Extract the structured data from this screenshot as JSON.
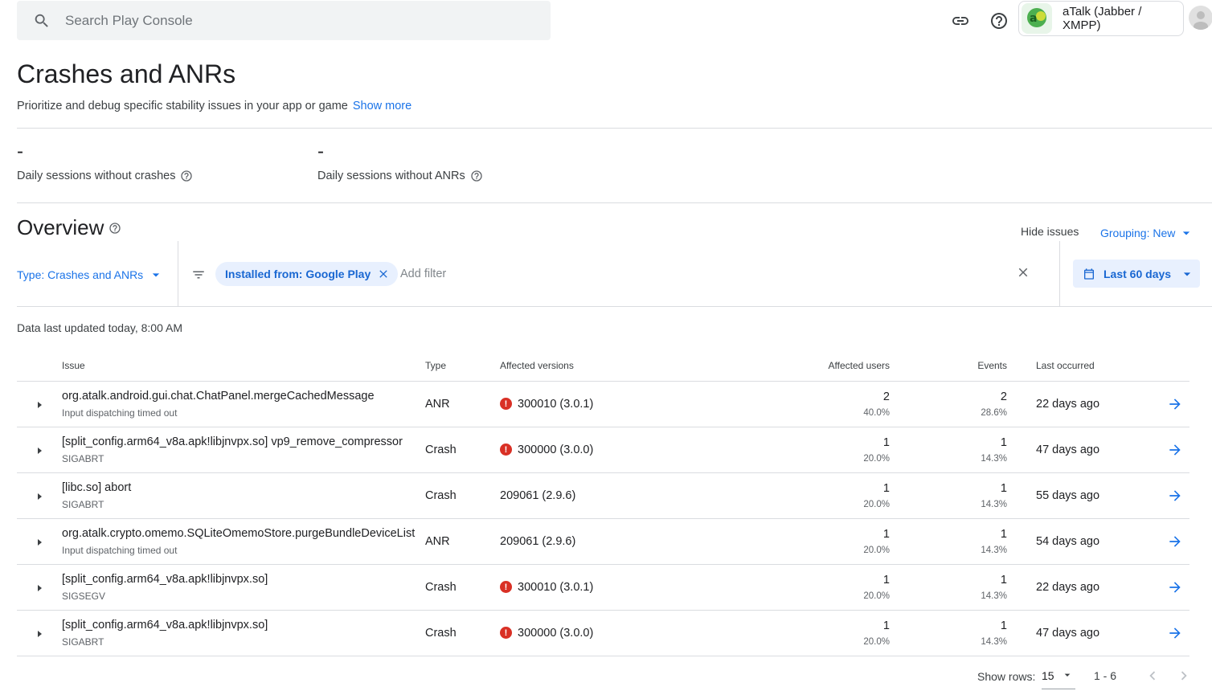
{
  "search": {
    "placeholder": "Search Play Console"
  },
  "top_bar": {
    "icons": [
      "link-icon",
      "help-icon"
    ],
    "app_name": "aTalk (Jabber / XMPP)"
  },
  "page": {
    "title": "Crashes and ANRs",
    "subtitle": "Prioritize and debug specific stability issues in your app or game",
    "show_more": "Show more"
  },
  "metrics": [
    {
      "value": "-",
      "label": "Daily sessions without crashes"
    },
    {
      "value": "-",
      "label": "Daily sessions without ANRs"
    }
  ],
  "overview": {
    "title": "Overview",
    "hide_issues": "Hide issues",
    "grouping": "Grouping: New",
    "type_filter": "Type: Crashes and ANRs",
    "active_filter": "Installed from: Google Play",
    "add_filter": "Add filter",
    "date_range": "Last 60 days",
    "updated": "Data last updated today, 8:00 AM"
  },
  "table": {
    "headers": [
      "Issue",
      "Type",
      "Affected versions",
      "Affected users",
      "Events",
      "Last occurred"
    ],
    "rows": [
      {
        "issue": "org.atalk.android.gui.chat.ChatPanel.mergeCachedMessage",
        "sub": "Input dispatching timed out",
        "type": "ANR",
        "version": "300010 (3.0.1)",
        "version_alert": true,
        "users": "2",
        "users_pct": "40.0%",
        "events": "2",
        "events_pct": "28.6%",
        "last": "22 days ago"
      },
      {
        "issue": "[split_config.arm64_v8a.apk!libjnvpx.so] vp9_remove_compressor",
        "sub": "SIGABRT",
        "type": "Crash",
        "version": "300000 (3.0.0)",
        "version_alert": true,
        "users": "1",
        "users_pct": "20.0%",
        "events": "1",
        "events_pct": "14.3%",
        "last": "47 days ago"
      },
      {
        "issue": "[libc.so] abort",
        "sub": "SIGABRT",
        "type": "Crash",
        "version": "209061 (2.9.6)",
        "version_alert": false,
        "users": "1",
        "users_pct": "20.0%",
        "events": "1",
        "events_pct": "14.3%",
        "last": "55 days ago"
      },
      {
        "issue": "org.atalk.crypto.omemo.SQLiteOmemoStore.purgeBundleDeviceList",
        "sub": "Input dispatching timed out",
        "type": "ANR",
        "version": "209061 (2.9.6)",
        "version_alert": false,
        "users": "1",
        "users_pct": "20.0%",
        "events": "1",
        "events_pct": "14.3%",
        "last": "54 days ago"
      },
      {
        "issue": "[split_config.arm64_v8a.apk!libjnvpx.so]",
        "sub": "SIGSEGV",
        "type": "Crash",
        "version": "300010 (3.0.1)",
        "version_alert": true,
        "users": "1",
        "users_pct": "20.0%",
        "events": "1",
        "events_pct": "14.3%",
        "last": "22 days ago"
      },
      {
        "issue": "[split_config.arm64_v8a.apk!libjnvpx.so]",
        "sub": "SIGABRT",
        "type": "Crash",
        "version": "300000 (3.0.0)",
        "version_alert": true,
        "users": "1",
        "users_pct": "20.0%",
        "events": "1",
        "events_pct": "14.3%",
        "last": "47 days ago"
      }
    ]
  },
  "pagination": {
    "show_rows_label": "Show rows:",
    "rows_per_page": "15",
    "range": "1 - 6"
  },
  "colors": {
    "accent": "#1a73e8",
    "error": "#d93025",
    "chip_bg": "#e8f0fe"
  }
}
